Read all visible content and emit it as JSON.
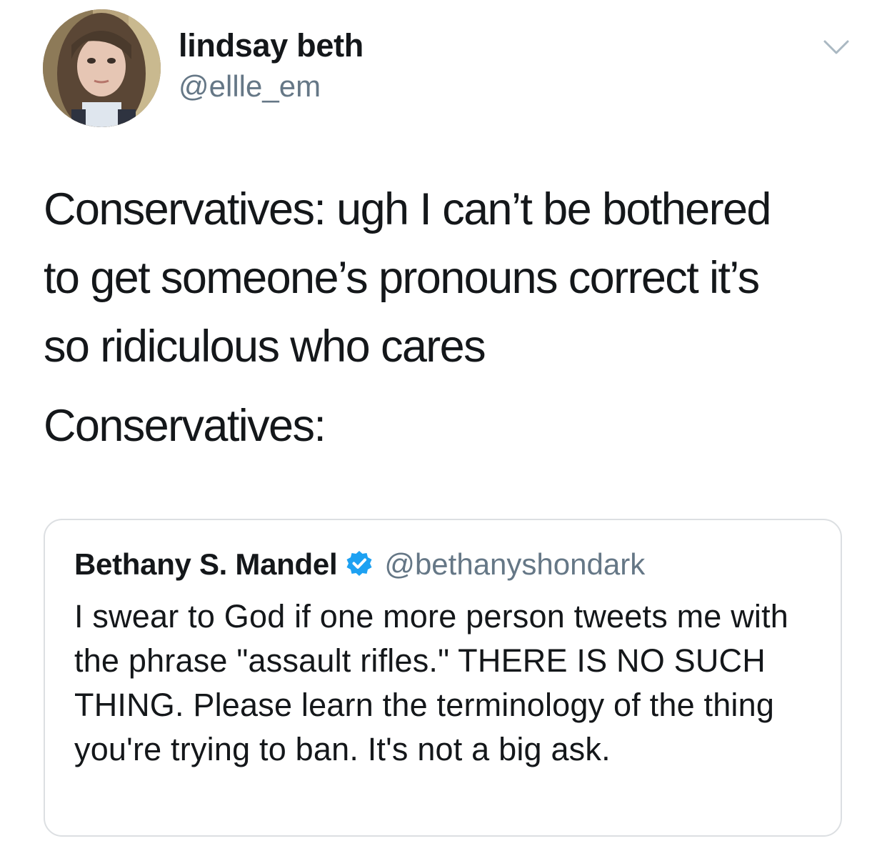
{
  "tweet": {
    "author": {
      "display_name": "lindsay beth",
      "handle": "@ellle_em",
      "avatar_icon": "profile-photo"
    },
    "menu_icon": "chevron-down-icon",
    "text_paragraph_1": "Conservatives: ugh I can’t be bothered\nto get someone’s pronouns correct it’s\nso ridiculous who cares",
    "text_paragraph_2": "Conservatives:"
  },
  "quoted_tweet": {
    "author": {
      "display_name": "Bethany S. Mandel",
      "handle": "@bethanyshondark",
      "verified": true,
      "verified_icon": "verified-badge-icon"
    },
    "text": "I swear to God if one more person tweets me with the phrase \"assault rifles.\" THERE IS NO SUCH THING. Please learn the terminology of the thing you're trying to ban. It's not a big ask."
  },
  "colors": {
    "text_primary": "#14171a",
    "text_secondary": "#657786",
    "verified_blue": "#1da1f2",
    "card_border": "#dcdfe2"
  }
}
